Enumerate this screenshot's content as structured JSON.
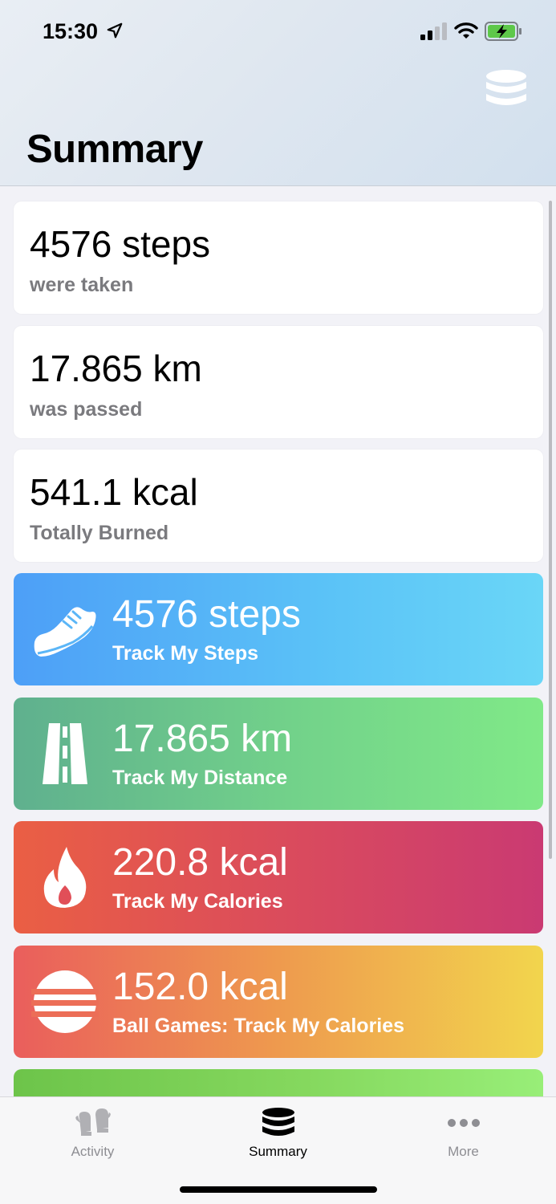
{
  "status_bar": {
    "time": "15:30"
  },
  "header": {
    "title": "Summary",
    "action_icon": "database-icon"
  },
  "stats": [
    {
      "value": "4576 steps",
      "label": "were taken"
    },
    {
      "value": "17.865 km",
      "label": "was passed"
    },
    {
      "value": "541.1 kcal",
      "label": "Totally Burned"
    }
  ],
  "trackers": [
    {
      "value": "4576 steps",
      "label": "Track My Steps",
      "icon": "shoe-icon"
    },
    {
      "value": "17.865 km",
      "label": "Track My Distance",
      "icon": "road-icon"
    },
    {
      "value": "220.8 kcal",
      "label": "Track My Calories",
      "icon": "flame-icon"
    },
    {
      "value": "152.0 kcal",
      "label": "Ball Games: Track My Calories",
      "icon": "ball-icon"
    }
  ],
  "tabbar": {
    "tabs": [
      {
        "label": "Activity",
        "icon": "mittens-icon",
        "active": false
      },
      {
        "label": "Summary",
        "icon": "database-icon",
        "active": true
      },
      {
        "label": "More",
        "icon": "ellipsis-icon",
        "active": false
      }
    ]
  },
  "colors": {
    "steps": "#4d9ff7",
    "distance": "#73d38a",
    "calories": "#d94a5e",
    "ball": "#ee9a4e"
  }
}
